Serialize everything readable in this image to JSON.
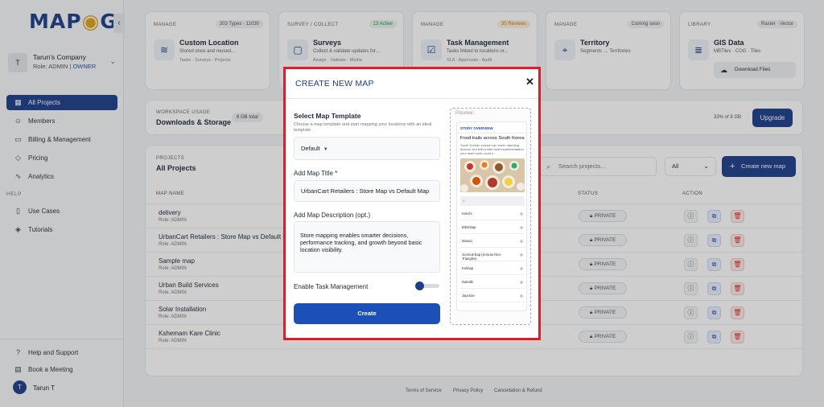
{
  "brand": {
    "logo_left": "MAP",
    "logo_right": "G"
  },
  "company": {
    "avatar": "T",
    "name": "Tarun's Company",
    "role_prefix": "Role: ADMIN | ",
    "role_highlight": "OWNER"
  },
  "sidebar": {
    "items": [
      {
        "label": "All Projects",
        "icon": "grid-icon"
      },
      {
        "label": "Members",
        "icon": "user-icon"
      },
      {
        "label": "Billing & Management",
        "icon": "card-icon"
      },
      {
        "label": "Pricing",
        "icon": "tag-icon"
      },
      {
        "label": "Analytics",
        "icon": "chart-icon"
      }
    ],
    "help_heading": "HELP",
    "help_items": [
      {
        "label": "Use Cases",
        "icon": "book-icon"
      },
      {
        "label": "Tutorials",
        "icon": "layers-icon"
      }
    ],
    "bottom_items": [
      {
        "label": "Help and Support",
        "icon": "question-icon"
      },
      {
        "label": "Book a Meeting",
        "icon": "calendar-icon"
      }
    ],
    "user": {
      "avatar": "T",
      "name": "Tarun T"
    }
  },
  "cards": [
    {
      "category": "MANAGE",
      "badge": "203 Types · 11030",
      "title": "Custom Location",
      "desc": "Stored once and reused...",
      "tags": "Tasks · Surveys · Projects"
    },
    {
      "category": "SURVEY / COLLECT",
      "badge": "13 Active",
      "title": "Surveys",
      "desc": "Collect & validate updates for...",
      "tags": "Assign · Validate · Media"
    },
    {
      "category": "MANAGE",
      "badge": "35 Reviews",
      "title": "Task Management",
      "desc": "Tasks linked to locations or...",
      "tags": "SLA · Approvals · Audit"
    },
    {
      "category": "MANAGE",
      "badge": "Coming soon",
      "title": "Territory",
      "desc": "Segments → Territories",
      "tags": ""
    },
    {
      "category": "LIBRARY",
      "badge": "Raster · Vector",
      "title": "GIS Data",
      "desc": "MBTiles · COG · Tiles",
      "download": "Download Files"
    }
  ],
  "usage": {
    "category": "WORKSPACE USAGE",
    "title": "Downloads & Storage",
    "pill": "8 GB total",
    "percent": "33% of 8 GB",
    "upgrade": "Upgrade"
  },
  "projects": {
    "category": "PROJECTS",
    "title": "All Projects",
    "search_placeholder": "Search projects...",
    "filter": "All",
    "create_label": "Create new map",
    "columns": {
      "name": "MAP NAME",
      "status": "STATUS",
      "action": "ACTION"
    },
    "rows": [
      {
        "name": "delivery",
        "role": "Role: ADMIN",
        "status": "PRIVATE"
      },
      {
        "name": "UrbanCart Retailers : Store Map vs Default Map",
        "role": "Role: ADMIN",
        "status": "PRIVATE"
      },
      {
        "name": "Sample map",
        "role": "Role: ADMIN",
        "status": "PRIVATE"
      },
      {
        "name": "Urban Build Services",
        "role": "Role: ADMIN",
        "status": "PRIVATE"
      },
      {
        "name": "Solar Installation",
        "role": "Role: ADMIN",
        "status": "PRIVATE"
      },
      {
        "name": "Kshemam Kare Clinic",
        "role": "Role: ADMIN",
        "status": "PRIVATE"
      }
    ]
  },
  "footer": {
    "terms": "Terms of Service",
    "privacy": "Privacy Policy",
    "refund": "Cancellation & Refund"
  },
  "modal": {
    "title": "CREATE NEW MAP",
    "template_label": "Select Map Template",
    "template_help": "Choose a map template and start mapping your locations with an ideal template.",
    "template_value": "Default",
    "title_label": "Add Map Title *",
    "title_value": "UrbanCart Retailers : Store Map vs Default Map",
    "desc_label": "Add Map Description (opt.)",
    "desc_value": "Store mapping enables smarter decisions, performance tracking, and growth beyond basic location visibility.",
    "task_label": "Enable Task Management",
    "task_enabled": true,
    "create_label": "Create",
    "preview": {
      "label": "Preview:",
      "header": "STORY OVERVIEW",
      "title": "Food trails across South Korea",
      "text": "South Korean cuisine can seem daunting diverse, but with a little bold experimentation, your taste buds could s...",
      "items": [
        "Kimchi",
        "Bibimbap",
        "Mandu",
        "Joomuk-bap (Korean Rice Triangles)",
        "Kimbap",
        "Dakalbi",
        "Japchae"
      ]
    }
  },
  "colors": {
    "primary": "#1d3f8a",
    "accent": "#1d4fb8",
    "highlight_border": "#d9202a",
    "danger": "#d03030"
  }
}
